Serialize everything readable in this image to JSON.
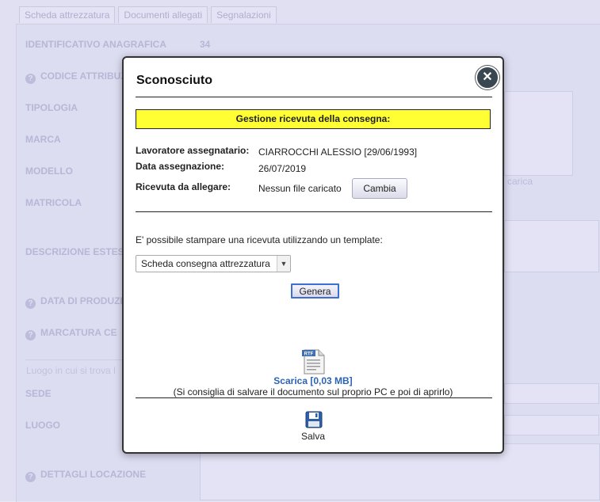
{
  "background": {
    "tabs": [
      "Scheda attrezzatura",
      "Documenti allegati",
      "Segnalazioni"
    ],
    "identificativo_label": "IDENTIFICATIVO ANAGRAFICA",
    "identificativo_value": "34",
    "fields": [
      "CODICE ATTRIBUZ",
      "TIPOLOGIA",
      "MARCA",
      "MODELLO",
      "MATRICOLA",
      "DESCRIZIONE ESTESA",
      "DATA DI PRODUZIO",
      "MARCATURA CE",
      "SEDE",
      "LUOGO",
      "DETTAGLI LOCAZIONE"
    ],
    "location_note": "Luogo in cui si trova l",
    "image_caption": "carica"
  },
  "modal": {
    "title": "Sconosciuto",
    "banner": "Gestione ricevuta della consegna:",
    "worker_label": "Lavoratore assegnatario:",
    "worker_value": "CIARROCCHI ALESSIO [29/06/1993]",
    "date_label": "Data assegnazione:",
    "date_value": "26/07/2019",
    "receipt_label": "Ricevuta da allegare:",
    "receipt_value": "Nessun file caricato",
    "change_button": "Cambia",
    "template_info": "E' possibile stampare una ricevuta utilizzando un template:",
    "template_selected": "Scheda consegna attrezzatura",
    "generate_button": "Genera",
    "file_badge": "RTF",
    "download_link": "Scarica [0,03 MB]",
    "download_hint": "(Si consiglia di salvare il documento sul proprio PC e poi di aprirlo)",
    "save_label": "Salva"
  },
  "icons": {
    "close": "close-icon",
    "file": "rtf-file-icon",
    "save": "floppy-disk-icon",
    "help": "question-icon",
    "dropdown": "chevron-down-icon"
  },
  "colors": {
    "banner": "#ffff33",
    "link": "#2b63b5",
    "close_button": "#3a4750",
    "focus_border": "#3b6fd1"
  }
}
